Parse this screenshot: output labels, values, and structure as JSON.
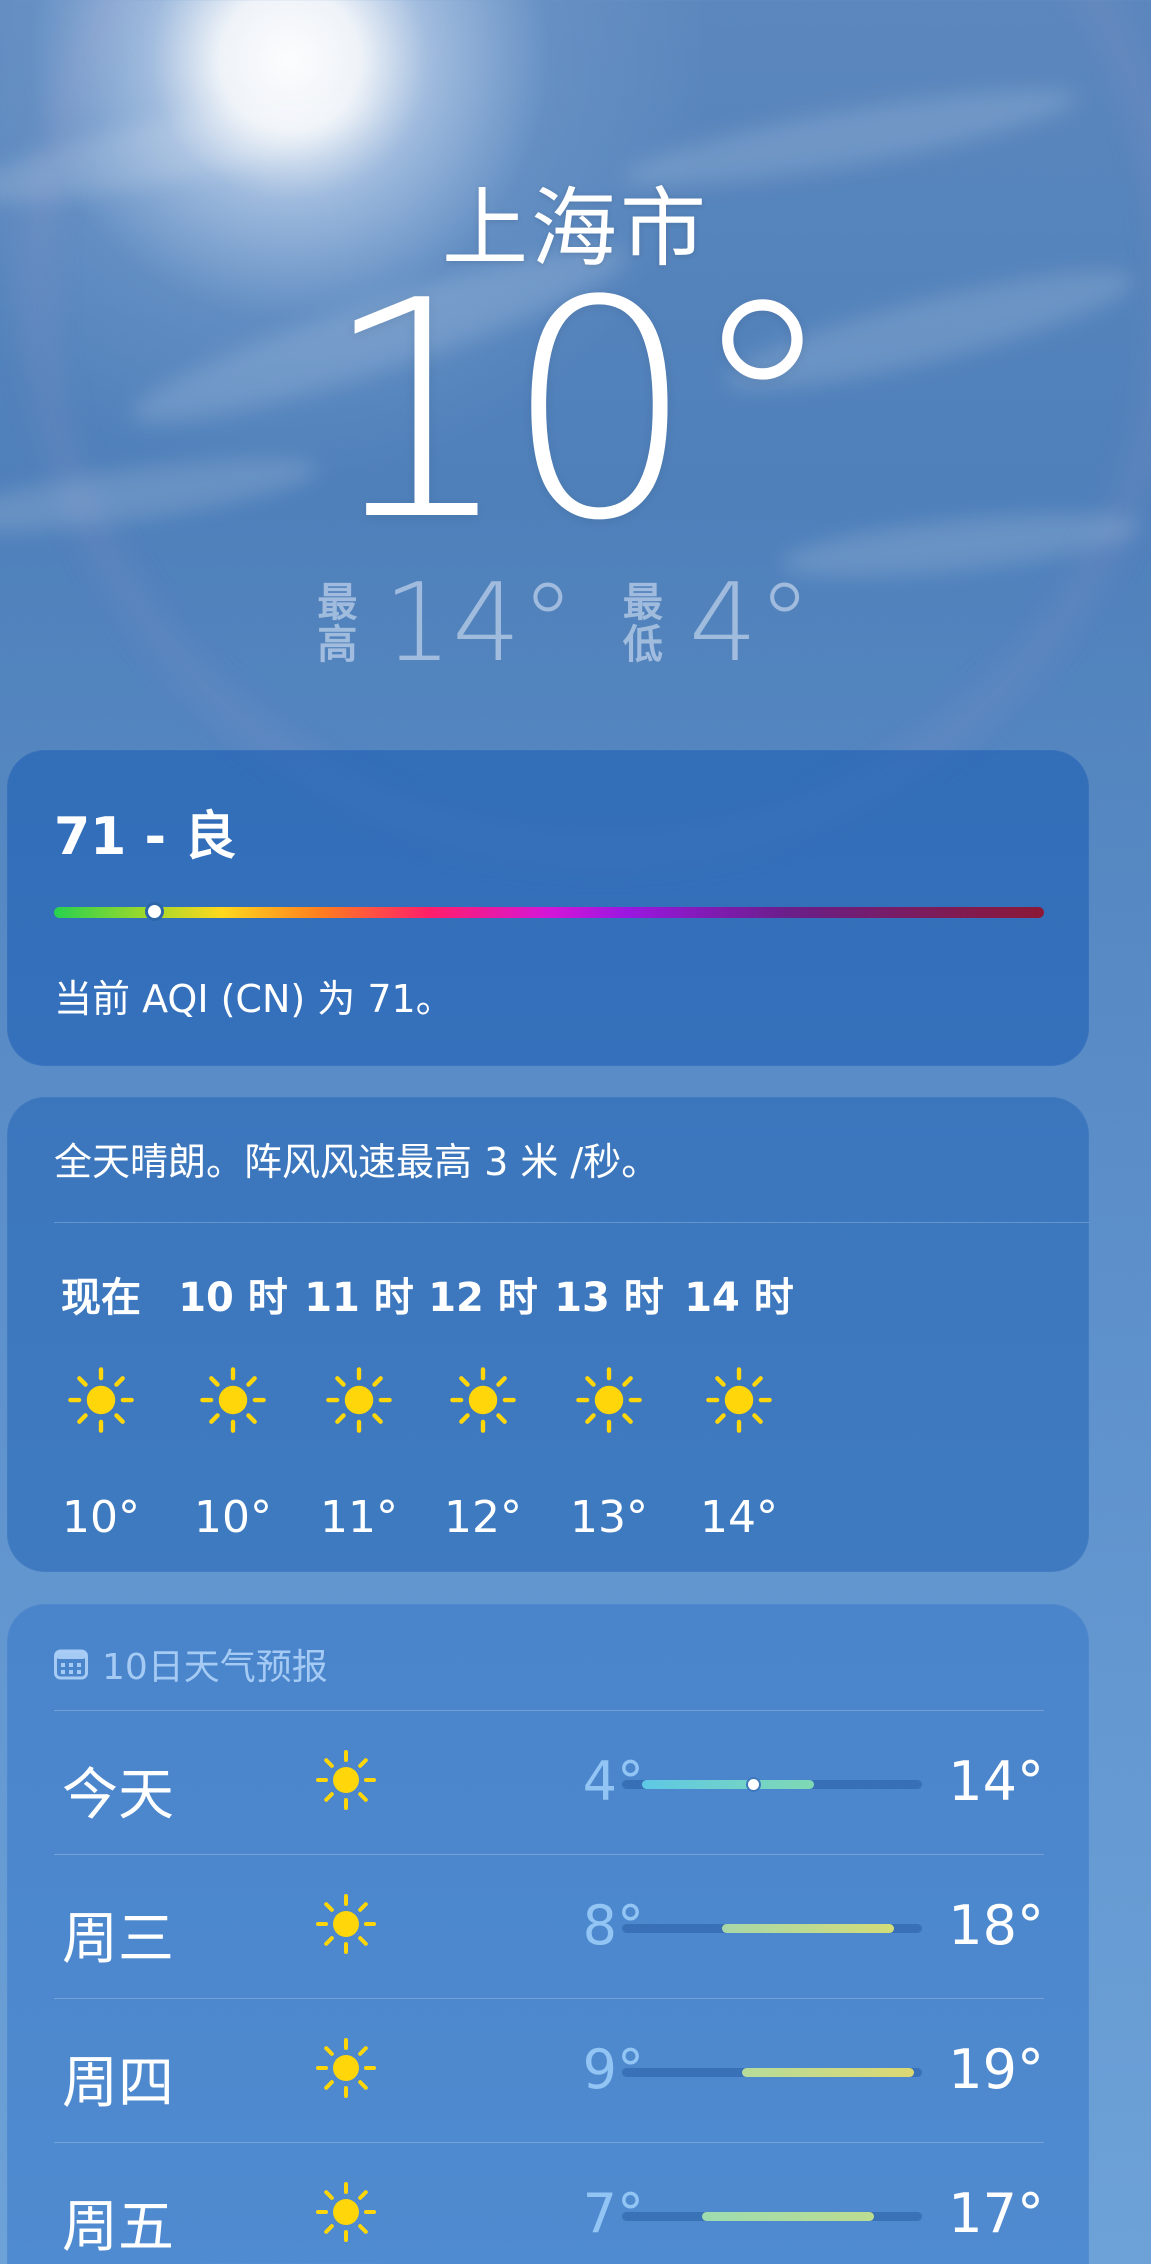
{
  "location": {
    "city": "上海市",
    "current_temp": "10°",
    "high_label": [
      "最",
      "高"
    ],
    "high_value": "14°",
    "low_label": [
      "最",
      "低"
    ],
    "low_value": "4°"
  },
  "aqi": {
    "title": "71 - 良",
    "description": "当前 AQI (CN) 为 71。",
    "value": 71
  },
  "hourly": {
    "summary": "全天晴朗。阵风风速最高 3 米 /秒。",
    "hours": [
      {
        "label": "现在",
        "icon": "sun-icon",
        "temp": "10°"
      },
      {
        "label": "10 时",
        "icon": "sun-icon",
        "temp": "10°"
      },
      {
        "label": "11 时",
        "icon": "sun-icon",
        "temp": "11°"
      },
      {
        "label": "12 时",
        "icon": "sun-icon",
        "temp": "12°"
      },
      {
        "label": "13 时",
        "icon": "sun-icon",
        "temp": "13°"
      },
      {
        "label": "14 时",
        "icon": "sun-icon",
        "temp": "14°"
      }
    ]
  },
  "daily": {
    "header": "10日天气预报",
    "header_icon": "calendar-icon",
    "days": [
      {
        "name": "今天",
        "icon": "sun-icon",
        "low": "4°",
        "high": "14°",
        "range": [
          4,
          14
        ],
        "current": 10,
        "color_from": "#5ec8e6",
        "color_to": "#7fd9b4"
      },
      {
        "name": "周三",
        "icon": "sun-icon",
        "low": "8°",
        "high": "18°",
        "range": [
          8,
          18
        ],
        "color_from": "#a8d8a8",
        "color_to": "#d4dd78"
      },
      {
        "name": "周四",
        "icon": "sun-icon",
        "low": "9°",
        "high": "19°",
        "range": [
          9,
          19
        ],
        "color_from": "#b6dc9a",
        "color_to": "#dcd872"
      },
      {
        "name": "周五",
        "icon": "sun-icon",
        "low": "7°",
        "high": "17°",
        "range": [
          7,
          17
        ],
        "color_from": "#9ddcb0",
        "color_to": "#bcdc90"
      }
    ],
    "scale_min": 4,
    "scale_max": 19
  },
  "colors": {
    "sun": "#ffd60a",
    "text": "#ffffff"
  }
}
